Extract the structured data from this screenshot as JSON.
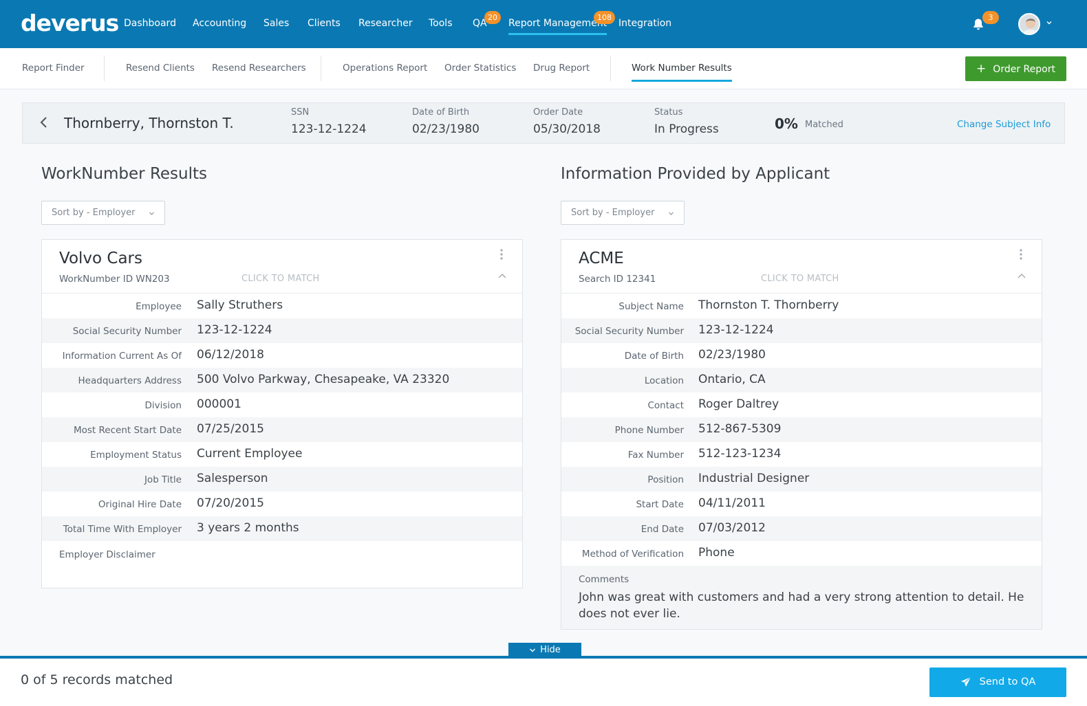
{
  "app": {
    "logo": "deverus"
  },
  "nav": {
    "items": [
      {
        "label": "Dashboard"
      },
      {
        "label": "Accounting"
      },
      {
        "label": "Sales"
      },
      {
        "label": "Clients"
      },
      {
        "label": "Researcher"
      },
      {
        "label": "Tools"
      },
      {
        "label": "QA",
        "badge": "20"
      },
      {
        "label": "Report Management",
        "badge": "108"
      },
      {
        "label": "Integration"
      }
    ],
    "active": "Report Management",
    "notifications_badge": "3"
  },
  "subnav": {
    "items": [
      {
        "label": "Report Finder"
      },
      {
        "label": "Resend Clients"
      },
      {
        "label": "Resend Researchers"
      },
      {
        "label": "Operations Report"
      },
      {
        "label": "Order Statistics"
      },
      {
        "label": "Drug Report"
      },
      {
        "label": "Work Number Results"
      }
    ],
    "active": "Work Number Results",
    "order_button": "Order Report"
  },
  "subject": {
    "name": "Thornberry, Thornston T.",
    "ssn_label": "SSN",
    "ssn": "123-12-1224",
    "dob_label": "Date of Birth",
    "dob": "02/23/1980",
    "order_date_label": "Order Date",
    "order_date": "05/30/2018",
    "status_label": "Status",
    "status": "In Progress",
    "match_percent": "0%",
    "match_label": "Matched",
    "change_link": "Change Subject Info"
  },
  "left": {
    "title": "WorkNumber Results",
    "sort": "Sort by - Employer",
    "card": {
      "title": "Volvo Cars",
      "subtitle": "WorkNumber ID WN203",
      "click_to_match": "CLICK TO MATCH",
      "rows": [
        {
          "label": "Employee",
          "value": "Sally Struthers"
        },
        {
          "label": "Social Security Number",
          "value": "123-12-1224"
        },
        {
          "label": "Information Current As Of",
          "value": "06/12/2018"
        },
        {
          "label": "Headquarters Address",
          "value": "500 Volvo Parkway, Chesapeake, VA 23320"
        },
        {
          "label": "Division",
          "value": "000001"
        },
        {
          "label": "Most Recent Start Date",
          "value": "07/25/2015"
        },
        {
          "label": "Employment Status",
          "value": "Current Employee"
        },
        {
          "label": "Job Title",
          "value": "Salesperson"
        },
        {
          "label": "Original Hire Date",
          "value": "07/20/2015"
        },
        {
          "label": "Total Time With Employer",
          "value": "3 years 2 months"
        }
      ],
      "footer_label": "Employer Disclaimer"
    }
  },
  "right": {
    "title": "Information Provided by Applicant",
    "sort": "Sort by - Employer",
    "card": {
      "title": "ACME",
      "subtitle": "Search ID 12341",
      "click_to_match": "CLICK TO MATCH",
      "rows": [
        {
          "label": "Subject Name",
          "value": "Thornston T. Thornberry"
        },
        {
          "label": "Social Security Number",
          "value": "123-12-1224"
        },
        {
          "label": "Date of Birth",
          "value": "02/23/1980"
        },
        {
          "label": "Location",
          "value": "Ontario, CA"
        },
        {
          "label": "Contact",
          "value": "Roger Daltrey"
        },
        {
          "label": "Phone Number",
          "value": "512-867-5309"
        },
        {
          "label": "Fax Number",
          "value": "512-123-1234"
        },
        {
          "label": "Position",
          "value": "Industrial Designer"
        },
        {
          "label": "Start Date",
          "value": "04/11/2011"
        },
        {
          "label": "End Date",
          "value": "07/03/2012"
        },
        {
          "label": "Method of Verification",
          "value": "Phone"
        }
      ],
      "comments_label": "Comments",
      "comments": "John was great with customers and had a very strong attention to detail. He does not ever lie."
    }
  },
  "footer": {
    "hide_label": "Hide",
    "records_matched": "0 of 5 records matched",
    "send_button": "Send to QA"
  },
  "colors": {
    "primary": "#0a79b3",
    "accent": "#12a9e8",
    "success": "#3f9a2e",
    "badge": "#f3922a"
  }
}
